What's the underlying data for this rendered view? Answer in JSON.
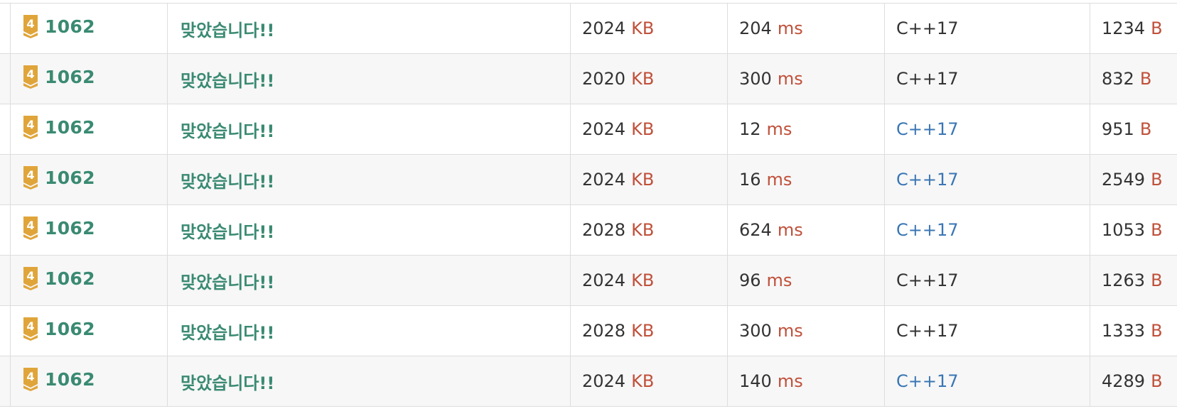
{
  "submissions": [
    {
      "problem_id": "1062",
      "tier": "4",
      "result": "맞았습니다!!",
      "memory": "2024",
      "memory_unit": "KB",
      "time": "204",
      "time_unit": "ms",
      "language": "C++17",
      "language_link": false,
      "code_length": "1234",
      "length_unit": "B"
    },
    {
      "problem_id": "1062",
      "tier": "4",
      "result": "맞았습니다!!",
      "memory": "2020",
      "memory_unit": "KB",
      "time": "300",
      "time_unit": "ms",
      "language": "C++17",
      "language_link": false,
      "code_length": "832",
      "length_unit": "B"
    },
    {
      "problem_id": "1062",
      "tier": "4",
      "result": "맞았습니다!!",
      "memory": "2024",
      "memory_unit": "KB",
      "time": "12",
      "time_unit": "ms",
      "language": "C++17",
      "language_link": true,
      "code_length": "951",
      "length_unit": "B"
    },
    {
      "problem_id": "1062",
      "tier": "4",
      "result": "맞았습니다!!",
      "memory": "2024",
      "memory_unit": "KB",
      "time": "16",
      "time_unit": "ms",
      "language": "C++17",
      "language_link": true,
      "code_length": "2549",
      "length_unit": "B"
    },
    {
      "problem_id": "1062",
      "tier": "4",
      "result": "맞았습니다!!",
      "memory": "2028",
      "memory_unit": "KB",
      "time": "624",
      "time_unit": "ms",
      "language": "C++17",
      "language_link": true,
      "code_length": "1053",
      "length_unit": "B"
    },
    {
      "problem_id": "1062",
      "tier": "4",
      "result": "맞았습니다!!",
      "memory": "2024",
      "memory_unit": "KB",
      "time": "96",
      "time_unit": "ms",
      "language": "C++17",
      "language_link": false,
      "code_length": "1263",
      "length_unit": "B"
    },
    {
      "problem_id": "1062",
      "tier": "4",
      "result": "맞았습니다!!",
      "memory": "2028",
      "memory_unit": "KB",
      "time": "300",
      "time_unit": "ms",
      "language": "C++17",
      "language_link": false,
      "code_length": "1333",
      "length_unit": "B"
    },
    {
      "problem_id": "1062",
      "tier": "4",
      "result": "맞았습니다!!",
      "memory": "2024",
      "memory_unit": "KB",
      "time": "140",
      "time_unit": "ms",
      "language": "C++17",
      "language_link": true,
      "code_length": "4289",
      "length_unit": "B"
    }
  ],
  "colors": {
    "accepted_green": "#3a8a72",
    "unit_red": "#c0503a",
    "link_blue": "#3a76b4",
    "tier_gold": "#e0a53a",
    "border": "#dddddd",
    "row_alt": "#f7f7f7"
  },
  "icons": {
    "tier_badge": "gold-tier-badge-icon"
  }
}
